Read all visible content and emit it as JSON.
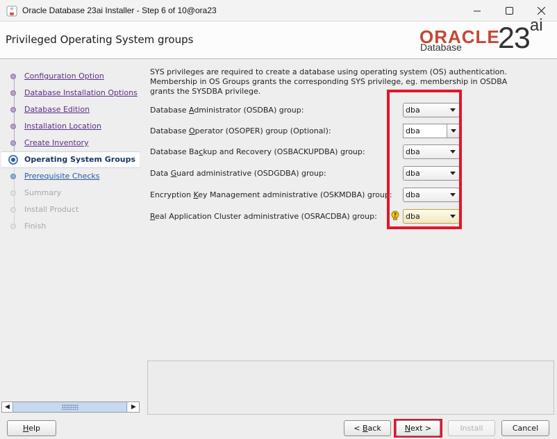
{
  "window": {
    "title": "Oracle Database 23ai Installer - Step 6 of 10@ora23",
    "controls": [
      "minimize",
      "maximize",
      "close"
    ]
  },
  "header": {
    "page_title": "Privileged Operating System groups",
    "logo": {
      "word": "ORACLE",
      "product": "Database",
      "version_num": "23",
      "version_suffix": "ai",
      "brand_color": "#c74634"
    }
  },
  "steps": [
    {
      "label": "Configuration Option",
      "state": "done"
    },
    {
      "label": "Database Installation Options",
      "state": "done"
    },
    {
      "label": "Database Edition",
      "state": "done"
    },
    {
      "label": "Installation Location",
      "state": "done"
    },
    {
      "label": "Create Inventory",
      "state": "done"
    },
    {
      "label": "Operating System Groups",
      "state": "current"
    },
    {
      "label": "Prerequisite Checks",
      "state": "next"
    },
    {
      "label": "Summary",
      "state": "future"
    },
    {
      "label": "Install Product",
      "state": "future"
    },
    {
      "label": "Finish",
      "state": "future"
    }
  ],
  "content": {
    "intro_line1": "SYS privileges are required to create a database using operating system (OS) authentication.",
    "intro_line2": "Membership in OS Groups grants the corresponding SYS privilege, eg. membership in OSDBA",
    "intro_line3": "grants the SYSDBA privilege.",
    "groups": [
      {
        "pre": "Database ",
        "mn": "A",
        "post": "dministrator (OSDBA) group:",
        "value": "dba"
      },
      {
        "pre": "Database ",
        "mn": "O",
        "post": "perator (OSOPER) group (Optional):",
        "value": "dba"
      },
      {
        "pre": "Database Ba",
        "mn": "c",
        "post": "kup and Recovery (OSBACKUPDBA) group:",
        "value": "dba"
      },
      {
        "pre": "Data ",
        "mn": "G",
        "post": "uard administrative (OSDGDBA) group:",
        "value": "dba"
      },
      {
        "pre": "Encryption ",
        "mn": "K",
        "post": "ey Management administrative (OSKMDBA) group:",
        "value": "dba"
      },
      {
        "pre": "",
        "mn": "R",
        "post": "eal Application Cluster administrative (OSRACDBA) group:",
        "value": "dba"
      }
    ]
  },
  "buttons": {
    "help_pre": "",
    "help_mn": "H",
    "help_post": "elp",
    "back_pre": "< ",
    "back_mn": "B",
    "back_post": "ack",
    "next_pre": "",
    "next_mn": "N",
    "next_post": "ext >",
    "install": "Install",
    "cancel": "Cancel"
  },
  "annotation_color": "#e3152b"
}
